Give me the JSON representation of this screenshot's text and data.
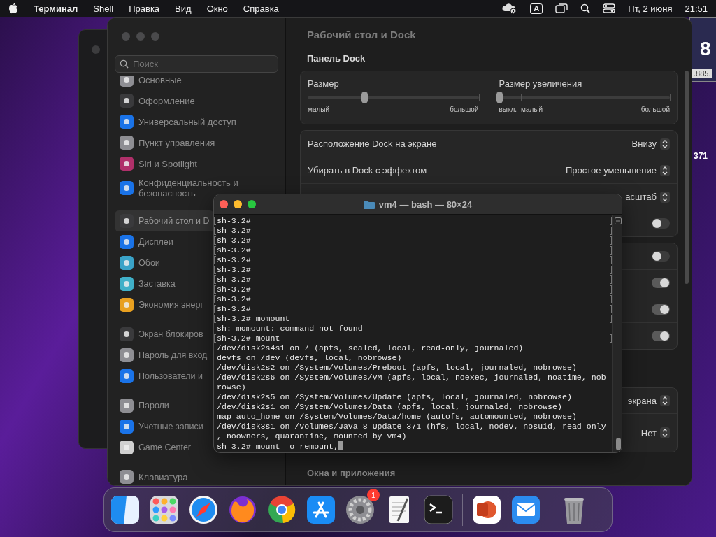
{
  "menu_bar": {
    "app": "Терминал",
    "items": [
      "Shell",
      "Правка",
      "Вид",
      "Окно",
      "Справка"
    ],
    "input_source": "A",
    "date": "Пт, 2 июня",
    "time": "21:51"
  },
  "background_window": {
    "big_text": "8",
    "caption": ".885.",
    "number": "371"
  },
  "settings": {
    "title": "Рабочий стол и Dock",
    "search": {
      "placeholder": "Поиск"
    },
    "sidebar_groups": [
      {
        "items": [
          {
            "label": "Основные",
            "color": "#8e8e93",
            "selected": false
          },
          {
            "label": "Оформление",
            "color": "#3a3a3c",
            "selected": false
          },
          {
            "label": "Универсальный доступ",
            "color": "#1a73e8",
            "selected": false
          },
          {
            "label": "Пункт управления",
            "color": "#8e8e93",
            "selected": false
          },
          {
            "label": "Siri и Spotlight",
            "color": "#b0306a",
            "selected": false
          },
          {
            "label": "Конфиденциальность и безопасность",
            "color": "#1a73e8",
            "selected": false
          }
        ]
      },
      {
        "items": [
          {
            "label": "Рабочий стол и D",
            "color": "#3a3a3c",
            "selected": true
          },
          {
            "label": "Дисплеи",
            "color": "#1a73e8",
            "selected": false
          },
          {
            "label": "Обои",
            "color": "#3aa3c8",
            "selected": false
          },
          {
            "label": "Заставка",
            "color": "#40b0c8",
            "selected": false
          },
          {
            "label": "Экономия энерг",
            "color": "#e8a020",
            "selected": false
          }
        ]
      },
      {
        "items": [
          {
            "label": "Экран блокиров",
            "color": "#3a3a3c",
            "selected": false
          },
          {
            "label": "Пароль для вход",
            "color": "#8e8e93",
            "selected": false
          },
          {
            "label": "Пользователи и",
            "color": "#1a73e8",
            "selected": false
          }
        ]
      },
      {
        "items": [
          {
            "label": "Пароли",
            "color": "#8e8e93",
            "selected": false
          },
          {
            "label": "Учетные записи",
            "color": "#1a73e8",
            "selected": false
          },
          {
            "label": "Game Center",
            "color": "#d0d0d0",
            "selected": false
          }
        ]
      },
      {
        "items": [
          {
            "label": "Клавиатура",
            "color": "#8e8e93",
            "selected": false
          }
        ]
      }
    ],
    "section": "Панель Dock",
    "sliders": [
      {
        "label": "Размер",
        "level": 0.33,
        "min_label": "малый",
        "max_label": "большой"
      },
      {
        "label": "Размер увеличения",
        "level": 0,
        "off_label": "выкл.",
        "min_label": "малый",
        "max_label": "большой"
      }
    ],
    "cards": [
      {
        "rows": [
          {
            "kind": "popup",
            "label": "Расположение Dock на экране",
            "value": "Внизу"
          },
          {
            "kind": "popup",
            "label": "Убирать в Dock с эффектом",
            "value": "Простое уменьшение"
          },
          {
            "kind": "popup",
            "value": "асштаб"
          },
          {
            "kind": "toggle",
            "on": false
          }
        ]
      },
      {
        "rows": [
          {
            "kind": "toggle",
            "on": false
          },
          {
            "kind": "toggle",
            "on": true
          },
          {
            "kind": "toggle",
            "on": true
          },
          {
            "kind": "toggle",
            "on": true
          }
        ]
      },
      {
        "rows": [
          {
            "kind": "popup",
            "value": "экрана"
          },
          {
            "kind": "popup",
            "value": "Нет"
          }
        ]
      }
    ],
    "next_section": "Окна и приложения"
  },
  "terminal": {
    "title": "vm4 — bash — 80×24",
    "cursor": true,
    "lines": [
      {
        "text": "sh-3.2#",
        "marked": true
      },
      {
        "text": "sh-3.2#",
        "marked": true
      },
      {
        "text": "sh-3.2#",
        "marked": true
      },
      {
        "text": "sh-3.2#",
        "marked": true
      },
      {
        "text": "sh-3.2#",
        "marked": true
      },
      {
        "text": "sh-3.2#",
        "marked": true
      },
      {
        "text": "sh-3.2#",
        "marked": true
      },
      {
        "text": "sh-3.2#",
        "marked": true
      },
      {
        "text": "sh-3.2#",
        "marked": true
      },
      {
        "text": "sh-3.2#",
        "marked": true
      },
      {
        "text": "sh-3.2# momount",
        "marked": true
      },
      {
        "text": "sh: momount: command not found",
        "marked": false
      },
      {
        "text": "sh-3.2# mount",
        "marked": true
      },
      {
        "text": "/dev/disk2s4s1 on / (apfs, sealed, local, read-only, journaled)",
        "marked": false
      },
      {
        "text": "devfs on /dev (devfs, local, nobrowse)",
        "marked": false
      },
      {
        "text": "/dev/disk2s2 on /System/Volumes/Preboot (apfs, local, journaled, nobrowse)",
        "marked": false
      },
      {
        "text": "/dev/disk2s6 on /System/Volumes/VM (apfs, local, noexec, journaled, noatime, nob",
        "marked": false
      },
      {
        "text": "rowse)",
        "marked": false
      },
      {
        "text": "/dev/disk2s5 on /System/Volumes/Update (apfs, local, journaled, nobrowse)",
        "marked": false
      },
      {
        "text": "/dev/disk2s1 on /System/Volumes/Data (apfs, local, journaled, nobrowse)",
        "marked": false
      },
      {
        "text": "map auto_home on /System/Volumes/Data/home (autofs, automounted, nobrowse)",
        "marked": false
      },
      {
        "text": "/dev/disk3s1 on /Volumes/Java 8 Update 371 (hfs, local, nodev, nosuid, read-only",
        "marked": false
      },
      {
        "text": ", noowners, quarantine, mounted by vm4)",
        "marked": false
      },
      {
        "text": "sh-3.2# mount -o remount,",
        "marked": false
      }
    ]
  },
  "dock": {
    "badge": "1"
  }
}
